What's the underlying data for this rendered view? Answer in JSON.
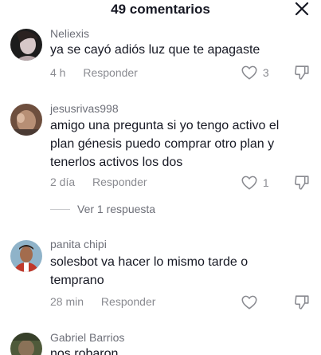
{
  "header": {
    "title": "49 comentarios",
    "close_icon": "close-icon"
  },
  "comments": [
    {
      "username": "Neliexis",
      "text": [
        "ya se cayó adiós luz que te apagaste"
      ],
      "time": "4 h",
      "reply_label": "Responder",
      "likes": "3"
    },
    {
      "username": "jesusrivas998",
      "text": [
        "amigo una pregunta si yo tengo activo el",
        "plan génesis puedo comprar otro plan y",
        "tenerlos activos los dos"
      ],
      "time": "2 día",
      "reply_label": "Responder",
      "likes": "1"
    },
    {
      "username": "panita chipi",
      "text": [
        "solesbot va hacer lo mismo tarde o",
        "temprano"
      ],
      "time": "28 min",
      "reply_label": "Responder",
      "likes": ""
    },
    {
      "username": "Gabriel Barrios",
      "text": [
        "nos robaron"
      ],
      "time": "",
      "reply_label": "",
      "likes": ""
    }
  ],
  "view_replies": {
    "label": "Ver 1 respuesta"
  },
  "icons": {
    "like": "heart-outline-icon",
    "dislike": "thumbs-down-icon"
  },
  "colors": {
    "text": "#161823",
    "secondary": "#8a8b91",
    "username": "#6d6f78"
  }
}
